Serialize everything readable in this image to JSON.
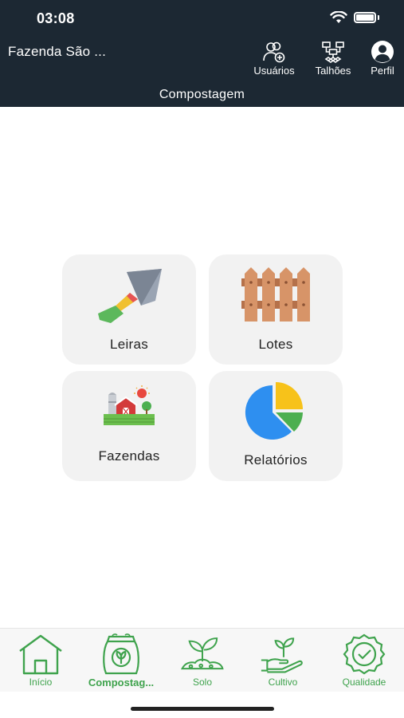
{
  "status_bar": {
    "time": "03:08"
  },
  "header": {
    "farm_name": "Fazenda São ...",
    "actions": [
      {
        "label": "Usuários",
        "icon": "users-add-icon"
      },
      {
        "label": "Talhões",
        "icon": "fields-network-icon"
      },
      {
        "label": "Perfil",
        "icon": "profile-icon"
      }
    ],
    "page_title": "Compostagem"
  },
  "cards": [
    {
      "label": "Leiras",
      "icon": "trowel-icon"
    },
    {
      "label": "Lotes",
      "icon": "fence-icon"
    },
    {
      "label": "Fazendas",
      "icon": "farm-icon"
    },
    {
      "label": "Relatórios",
      "icon": "pie-chart-icon"
    }
  ],
  "bottom_nav": [
    {
      "label": "Início",
      "icon": "home-icon"
    },
    {
      "label": "Compostag...",
      "icon": "compost-bag-icon",
      "active": true
    },
    {
      "label": "Solo",
      "icon": "soil-sprout-icon"
    },
    {
      "label": "Cultivo",
      "icon": "hand-plant-icon"
    },
    {
      "label": "Qualidade",
      "icon": "quality-badge-icon"
    }
  ],
  "colors": {
    "header_bg": "#1c2833",
    "card_bg": "#f2f2f2",
    "nav_accent": "#3fa34d"
  }
}
